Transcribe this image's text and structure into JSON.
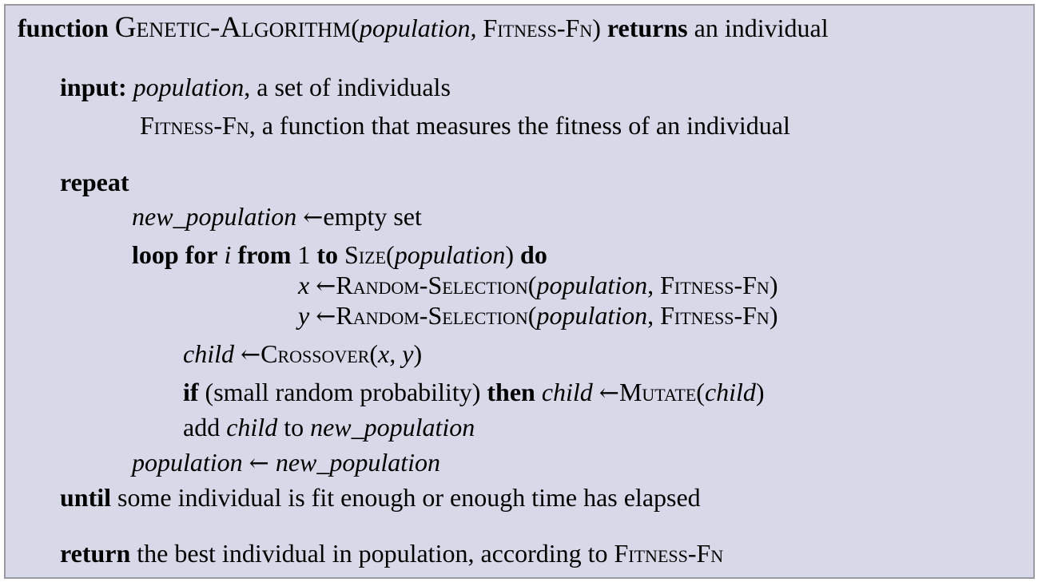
{
  "header": {
    "kw_function": "function",
    "name": "Genetic-Algorithm",
    "open_paren": "(",
    "param1": "population,",
    "param2": "Fitness-Fn",
    "close_paren": ")",
    "kw_returns": "returns",
    "return_desc": "an individual"
  },
  "inputs": {
    "kw_input": "input:",
    "pop_name": "population",
    "pop_desc": ", a set of individuals",
    "fit_name": "Fitness-Fn",
    "fit_desc": ", a function that measures the fitness of an individual"
  },
  "repeat": {
    "kw_repeat": "repeat",
    "newpop_var": "new_population",
    "arrow": "←",
    "empty_set": "empty set"
  },
  "loop": {
    "kw_loop_for": "loop for",
    "var_i": "i",
    "kw_from": "from",
    "num_1": "1",
    "kw_to": "to",
    "size_fn": "Size",
    "size_open": "(",
    "size_arg": "population",
    "size_close": ")",
    "kw_do": "do"
  },
  "select_x": {
    "var": "x",
    "arrow": "←",
    "fn": "Random-Selection",
    "open": "(",
    "arg1": "population",
    "comma": ", ",
    "arg2": "Fitness-Fn",
    "close": ")"
  },
  "select_y": {
    "var": "y",
    "arrow": "←",
    "fn": "Random-Selection",
    "open": "(",
    "arg1": "population",
    "comma": ", ",
    "arg2": "Fitness-Fn",
    "close": ")"
  },
  "crossover": {
    "var": "child",
    "arrow": "←",
    "fn": "Crossover",
    "open": "(",
    "args": "x, y",
    "close": ")"
  },
  "mutate": {
    "kw_if": "if",
    "condition": "(small random probability)",
    "kw_then": "then",
    "var": "child",
    "arrow": "←",
    "fn": "Mutate",
    "open": "(",
    "arg": "child",
    "close": ")"
  },
  "add": {
    "kw_add": "add",
    "var": "child",
    "kw_to": "to",
    "target": "new_population"
  },
  "assign": {
    "var": "population",
    "arrow": "←",
    "value": "new_population"
  },
  "until": {
    "kw_until": "until",
    "condition": "some individual is fit enough or enough time has elapsed"
  },
  "return_stmt": {
    "kw_return": "return",
    "text": "the best individual in population, according to",
    "fn": "Fitness-Fn"
  },
  "colors": {
    "box_background": "#d7d9e8",
    "box_border": "#9a9aa2",
    "text": "#000000"
  }
}
